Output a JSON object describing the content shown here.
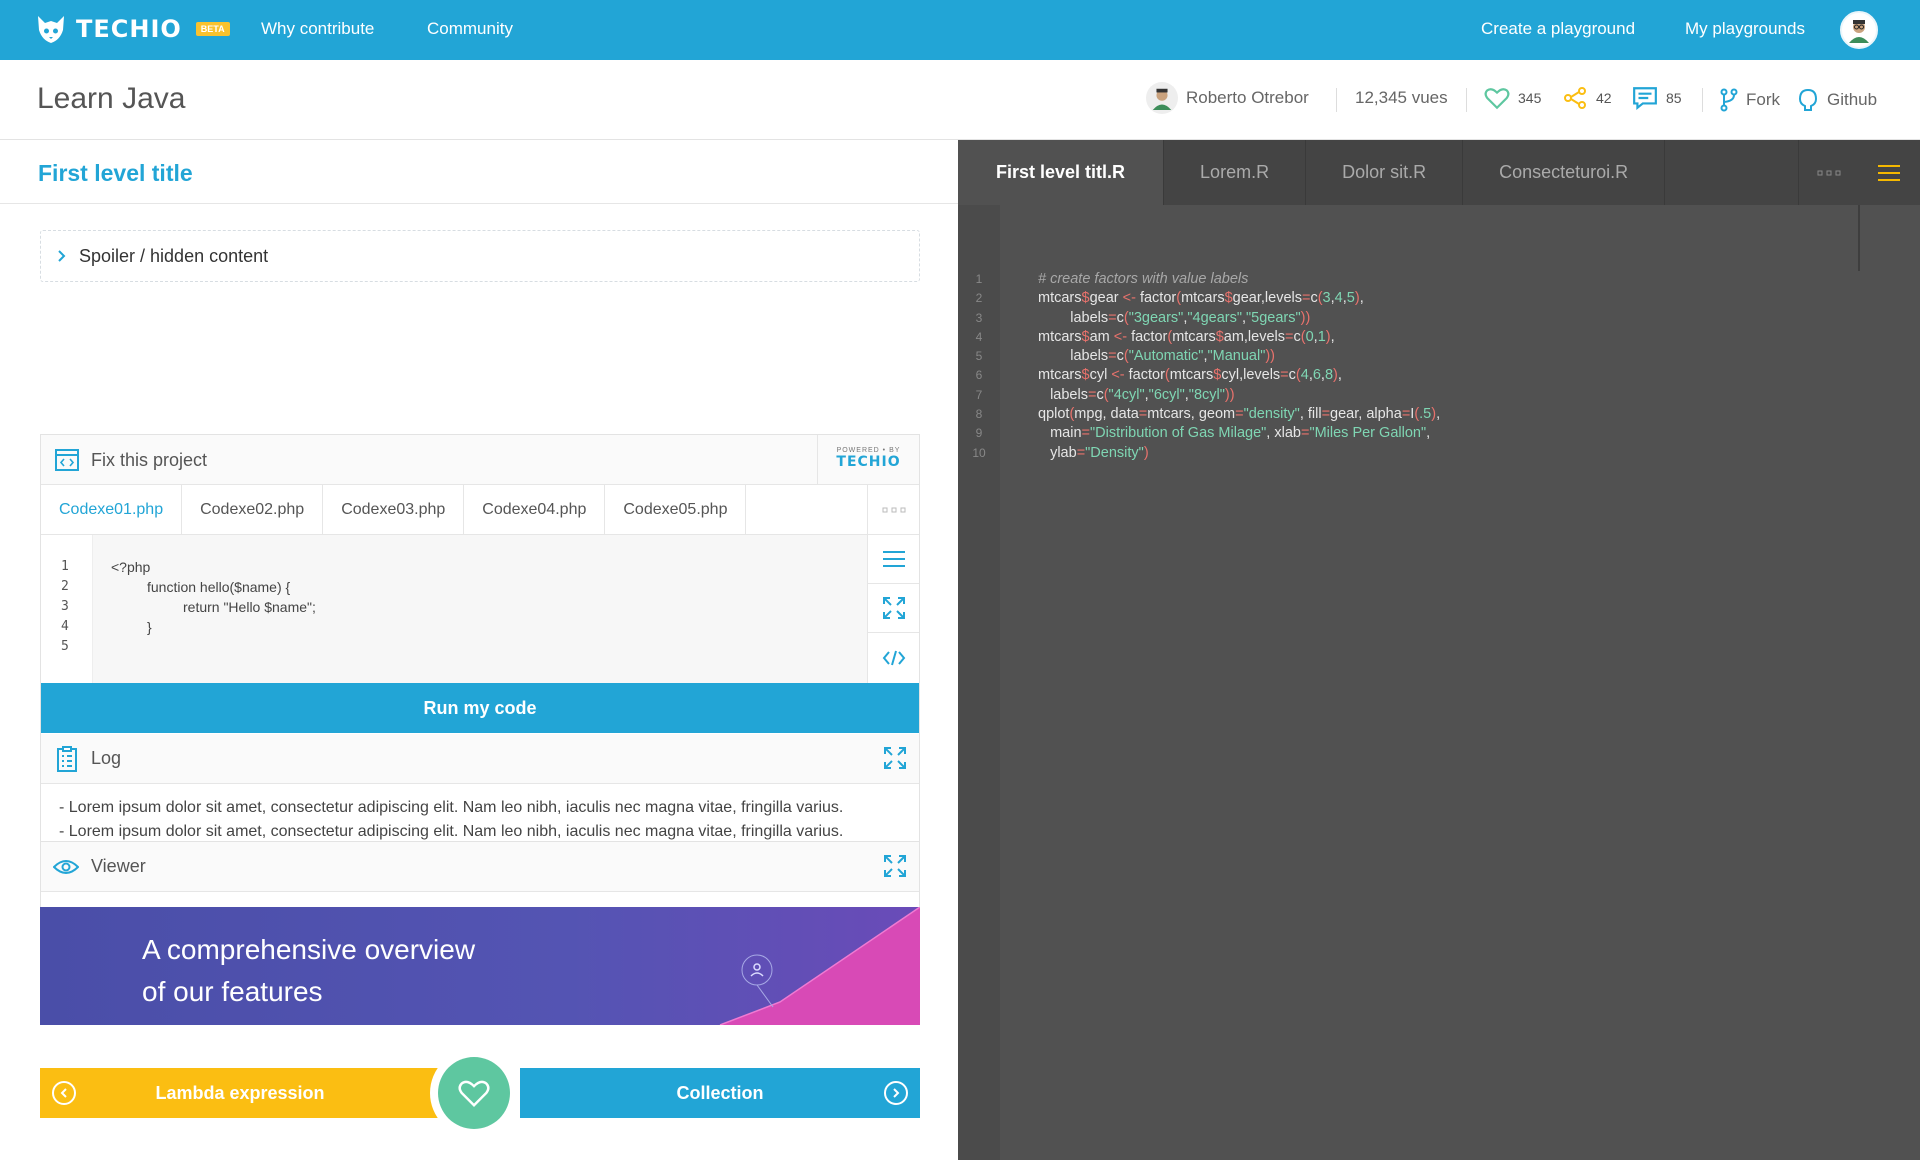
{
  "colors": {
    "brand": "#22a5d6",
    "warning": "#fbbe12",
    "success": "#5ec7a0",
    "editor_bg": "#515151"
  },
  "topnav": {
    "brand": "TECHIO",
    "beta": "BETA",
    "links": [
      "Why contribute",
      "Community"
    ],
    "right_links": [
      "Create a playground",
      "My playgrounds"
    ]
  },
  "header": {
    "title": "Learn Java",
    "author": "Roberto Otrebor",
    "views": "12,345 vues",
    "likes": "345",
    "shares": "42",
    "comments": "85",
    "fork": "Fork",
    "github": "Github"
  },
  "lesson": {
    "section_title": "First level title",
    "spoiler": "Spoiler / hidden content"
  },
  "widget": {
    "title": "Fix this project",
    "powered_small": "POWERED • BY",
    "powered_brand": "TECHIO",
    "tabs": [
      "Codexe01.php",
      "Codexe02.php",
      "Codexe03.php",
      "Codexe04.php",
      "Codexe05.php"
    ],
    "line_numbers": [
      "1",
      "2",
      "3",
      "4",
      "5"
    ],
    "code": [
      "<?php",
      "",
      "function hello($name) {",
      "return \"Hello $name\";",
      "}"
    ],
    "run_label": "Run my code",
    "log_title": "Log",
    "log_lines": [
      "- Lorem ipsum dolor sit amet, consectetur adipiscing elit. Nam leo nibh, iaculis nec magna vitae, fringilla varius.",
      "- Lorem ipsum dolor sit amet, consectetur adipiscing elit. Nam leo nibh, iaculis nec magna vitae, fringilla varius."
    ],
    "viewer_title": "Viewer",
    "viewer_text_1": "A comprehensive overview",
    "viewer_text_2": "of our features"
  },
  "pager": {
    "prev": "Lambda expression",
    "next": "Collection"
  },
  "editor": {
    "tabs": [
      "First level titl.R",
      "Lorem.R",
      "Dolor sit.R",
      "Consecteturoi.R"
    ],
    "line_numbers": [
      "1",
      "2",
      "3",
      "4",
      "5",
      "6",
      "7",
      "8",
      "9",
      "10"
    ]
  }
}
